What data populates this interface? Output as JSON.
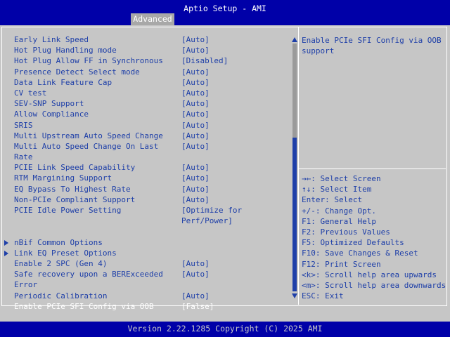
{
  "app": {
    "title": "Aptio Setup - AMI",
    "tab": "Advanced",
    "footer": "Version 2.22.1285 Copyright (C) 2025 AMI"
  },
  "settings": [
    {
      "label": "Early Link Speed",
      "value": "[Auto]"
    },
    {
      "label": "Hot Plug Handling mode",
      "value": "[Auto]"
    },
    {
      "label": "Hot Plug Allow FF in Synchronous",
      "value": "[Disabled]"
    },
    {
      "label": "Presence Detect Select mode",
      "value": "[Auto]"
    },
    {
      "label": "Data Link Feature Cap",
      "value": "[Auto]"
    },
    {
      "label": "CV test",
      "value": "[Auto]"
    },
    {
      "label": "SEV-SNP Support",
      "value": "[Auto]"
    },
    {
      "label": "Allow Compliance",
      "value": "[Auto]"
    },
    {
      "label": "SRIS",
      "value": "[Auto]"
    },
    {
      "label": "Multi Upstream Auto Speed Change",
      "value": "[Auto]"
    },
    {
      "label": "Multi Auto Speed Change On Last",
      "value": "[Auto]"
    },
    {
      "label": "Rate",
      "value": ""
    },
    {
      "label": "PCIE Link Speed Capability",
      "value": "[Auto]"
    },
    {
      "label": "RTM Margining Support",
      "value": "[Auto]"
    },
    {
      "label": "EQ Bypass To Highest Rate",
      "value": "[Auto]"
    },
    {
      "label": "Non-PCIe Compliant Support",
      "value": "[Auto]"
    },
    {
      "label": "PCIE Idle Power Setting",
      "value": "[Optimize for"
    },
    {
      "label": "",
      "value": "Perf/Power]"
    },
    {
      "label": "",
      "value": ""
    },
    {
      "label": "nBif Common Options",
      "value": "",
      "submenu": true
    },
    {
      "label": "Link EQ Preset Options",
      "value": "",
      "submenu": true
    },
    {
      "label": "Enable 2 SPC (Gen 4)",
      "value": "[Auto]"
    },
    {
      "label": "Safe recovery upon a BERExceeded",
      "value": "[Auto]"
    },
    {
      "label": "Error",
      "value": ""
    },
    {
      "label": "Periodic Calibration",
      "value": "[Auto]"
    },
    {
      "label": "Enable PCIe SFI Config via OOB",
      "value": "[False]",
      "selected": true
    }
  ],
  "help": {
    "text": "Enable PCIe SFI Config via OOB support"
  },
  "legend": [
    "→←: Select Screen",
    "↑↓: Select Item",
    "Enter: Select",
    "+/-: Change Opt.",
    "F1: General Help",
    "F2: Previous Values",
    "F5: Optimized Defaults",
    "F10: Save Changes & Reset",
    "F12: Print Screen",
    "<k>: Scroll help area upwards",
    "<m>: Scroll help area downwards",
    "ESC: Exit"
  ],
  "colors": {
    "title_bar": "#0000a8",
    "panel": "#c6c6c6",
    "text": "#1e3fa8",
    "selected_text": "#ffffff"
  }
}
